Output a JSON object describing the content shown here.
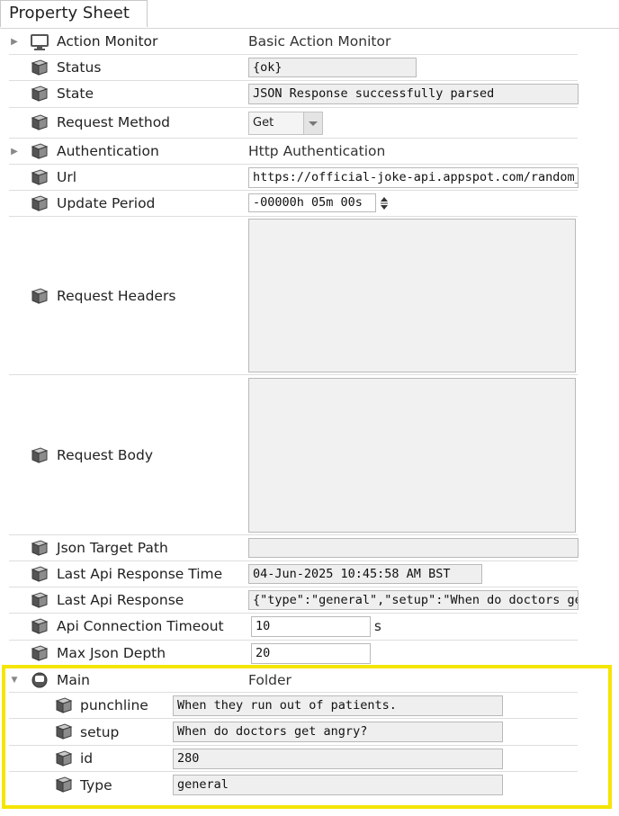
{
  "tab": {
    "title": "Property Sheet"
  },
  "rows": {
    "action_monitor": {
      "label": "Action Monitor",
      "value": "Basic Action Monitor"
    },
    "status": {
      "label": "Status",
      "value": "{ok}"
    },
    "state": {
      "label": "State",
      "value": "JSON Response successfully parsed"
    },
    "request_method": {
      "label": "Request Method",
      "value": "Get"
    },
    "authentication": {
      "label": "Authentication",
      "value": "Http Authentication"
    },
    "url": {
      "label": "Url",
      "value": "https://official-joke-api.appspot.com/random_joke"
    },
    "update_period": {
      "label": "Update Period",
      "value": "-00000h 05m 00s"
    },
    "request_headers": {
      "label": "Request Headers",
      "value": ""
    },
    "request_body": {
      "label": "Request Body",
      "value": ""
    },
    "json_target_path": {
      "label": "Json Target Path",
      "value": ""
    },
    "last_api_response_time": {
      "label": "Last Api Response Time",
      "value": "04-Jun-2025 10:45:58 AM BST"
    },
    "last_api_response": {
      "label": "Last Api Response",
      "value": "{\"type\":\"general\",\"setup\":\"When do doctors get angry?\""
    },
    "api_connection_timeout": {
      "label": "Api Connection Timeout",
      "value": "10",
      "unit": "s"
    },
    "max_json_depth": {
      "label": "Max Json Depth",
      "value": "20"
    },
    "main": {
      "label": "Main",
      "value": "Folder"
    },
    "punchline": {
      "label": "punchline",
      "value": "When they run out of patients."
    },
    "setup": {
      "label": "setup",
      "value": "When do doctors get angry?"
    },
    "id": {
      "label": "id",
      "value": "280"
    },
    "type": {
      "label": "Type",
      "value": "general"
    }
  },
  "colors": {
    "highlight_border": "#f5e500",
    "field_background": "#efefef",
    "field_border": "#b9b9b9"
  },
  "icons": {
    "action_monitor": "monitor-icon",
    "properties": "cube-icon",
    "main": "folder-node-icon",
    "collapsed": "triangle-right-icon",
    "expanded": "triangle-down-icon"
  }
}
